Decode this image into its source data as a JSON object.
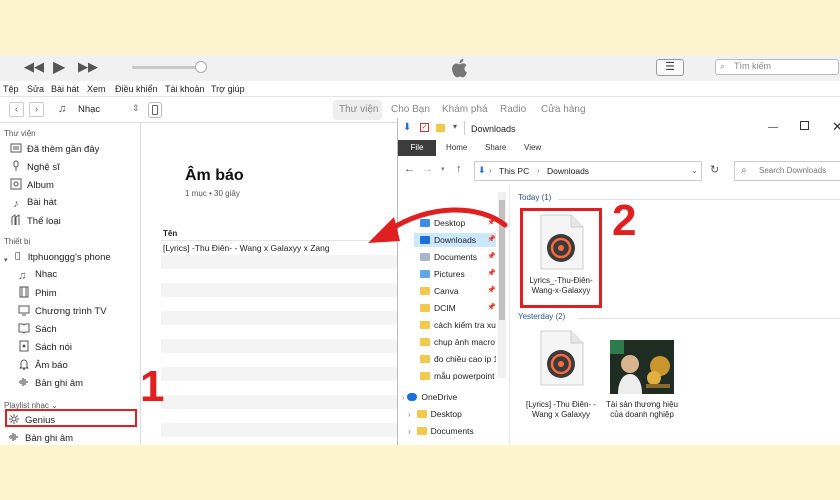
{
  "itunes": {
    "search_placeholder": "Tìm kiếm",
    "menu": [
      "Tệp",
      "Sửa",
      "Bài hát",
      "Xem",
      "Điều khiển",
      "Tài khoản",
      "Trợ giúp"
    ],
    "nav": {
      "media_selector": "Nhạc"
    },
    "store_tabs": [
      "Thư viện",
      "Cho Bạn",
      "Khám phá",
      "Radio",
      "Cửa hàng"
    ],
    "sidebar": {
      "library_header": "Thư viện",
      "library_items": [
        {
          "label": "Đã thêm gần đây",
          "icon": "recent-icon"
        },
        {
          "label": "Nghệ sĩ",
          "icon": "microphone-icon"
        },
        {
          "label": "Album",
          "icon": "album-icon"
        },
        {
          "label": "Bài hát",
          "icon": "music-note-icon"
        },
        {
          "label": "Thể loại",
          "icon": "genre-icon"
        }
      ],
      "devices_header": "Thiết bị",
      "device_name": "ltphuonggg's phone",
      "device_items": [
        {
          "label": "Nhạc",
          "icon": "music-note-icon"
        },
        {
          "label": "Phim",
          "icon": "film-icon"
        },
        {
          "label": "Chương trình TV",
          "icon": "tv-icon"
        },
        {
          "label": "Sách",
          "icon": "book-icon"
        },
        {
          "label": "Sách nói",
          "icon": "audiobook-icon"
        },
        {
          "label": "Âm báo",
          "icon": "bell-icon"
        },
        {
          "label": "Bản ghi âm",
          "icon": "voice-memo-icon"
        }
      ],
      "playlist_header": "Playlist nhạc ⌄",
      "playlist_items": [
        {
          "label": "Genius",
          "icon": "genius-icon"
        },
        {
          "label": "Bản ghi âm",
          "icon": "voice-memo-icon"
        }
      ]
    },
    "main": {
      "title": "Âm báo",
      "subtitle": "1 mục • 30 giây",
      "column_header": "Tên",
      "rows": [
        "[Lyrics] -Thu Điên- - Wang x Galaxyy x Zang"
      ]
    }
  },
  "explorer": {
    "title": "Downloads",
    "ribbon": [
      "File",
      "Home",
      "Share",
      "View"
    ],
    "address": [
      "This PC",
      "Downloads"
    ],
    "search_placeholder": "Search Downloads",
    "nav_items": [
      "Desktop",
      "Downloads",
      "Documents",
      "Pictures",
      "Canva",
      "DCIM",
      "cách kiếm tra xuất",
      "chụp ảnh macro",
      "đo chiều cao ip 1",
      "mẫu powerpoint",
      "OneDrive",
      "Desktop",
      "Documents"
    ],
    "groups": [
      {
        "label": "Today (1)",
        "files": [
          "Lyrics_-Thu-Điên-Wang-x-Galaxyy"
        ]
      },
      {
        "label": "Yesterday (2)",
        "files": [
          "[Lyrics] -Thu Điên- - Wang x Galaxyy",
          "Tài sản thương hiệu của doanh nghiệp"
        ]
      }
    ]
  },
  "annotations": [
    "1",
    "2"
  ],
  "colors": {
    "highlight": "#e02020",
    "background": "#fdf3cc",
    "link_blue": "#2b5797"
  }
}
